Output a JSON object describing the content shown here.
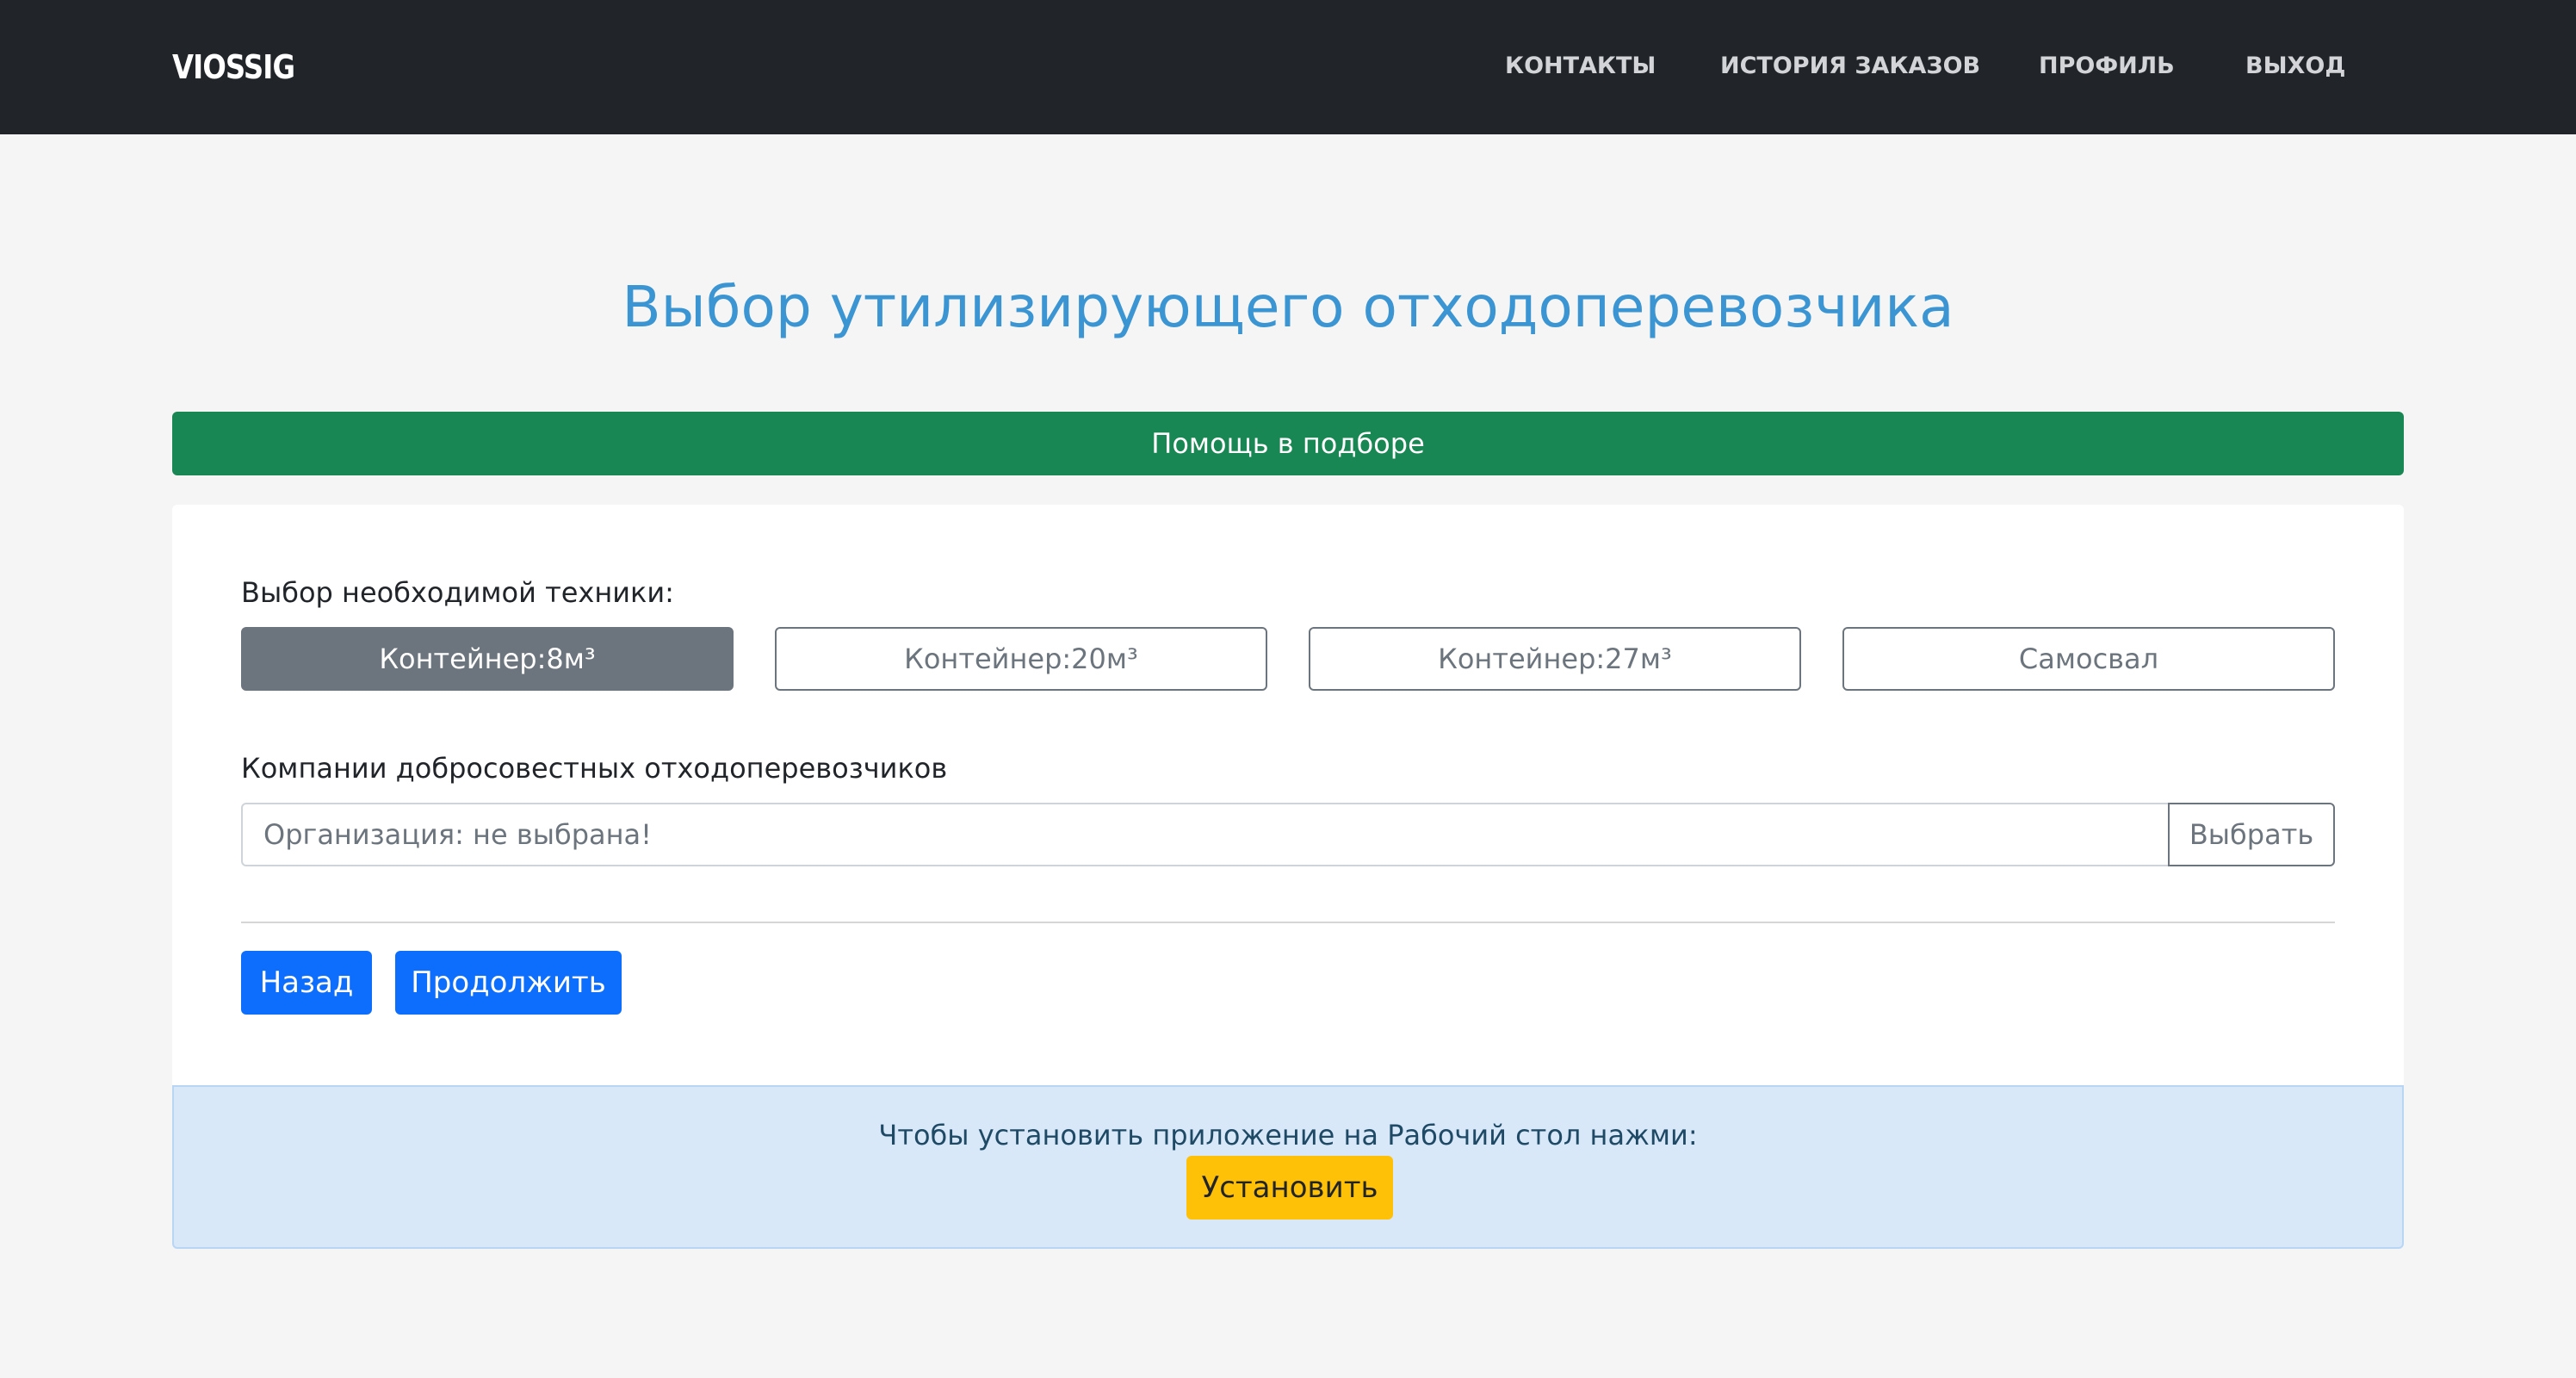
{
  "navbar": {
    "logo_text": "VIOSSIG",
    "links": [
      "КОНТАКТЫ",
      "ИСТОРИЯ ЗАКАЗОВ",
      "ПРОФИЛЬ",
      "ВЫХОД"
    ]
  },
  "page": {
    "title": "Выбор утилизирующего отходоперевозчика",
    "help_button": "Помощь в подборе"
  },
  "equipment": {
    "label": "Выбор необходимой техники:",
    "options": [
      "Контейнер:8м³",
      "Контейнер:20м³",
      "Контейнер:27м³",
      "Самосвал"
    ],
    "selected": "Контейнер:8м³"
  },
  "companies": {
    "label": "Компании добросовестных отходоперевозчиков",
    "input_value": "Организация: не выбрана!",
    "pick_button": "Выбрать"
  },
  "actions": {
    "back": "Назад",
    "separator": "|",
    "continue": "Продолжить"
  },
  "install": {
    "text": "Чтобы установить приложение на Рабочий стол нажми:",
    "button": "Установить"
  },
  "colors": {
    "navbar_bg": "#212529",
    "title": "#3b95d2",
    "help_green": "#198754",
    "primary_blue": "#0d6efd",
    "secondary_gray": "#6c757d",
    "install_bg": "#d8e8f8",
    "install_button": "#ffc107"
  }
}
